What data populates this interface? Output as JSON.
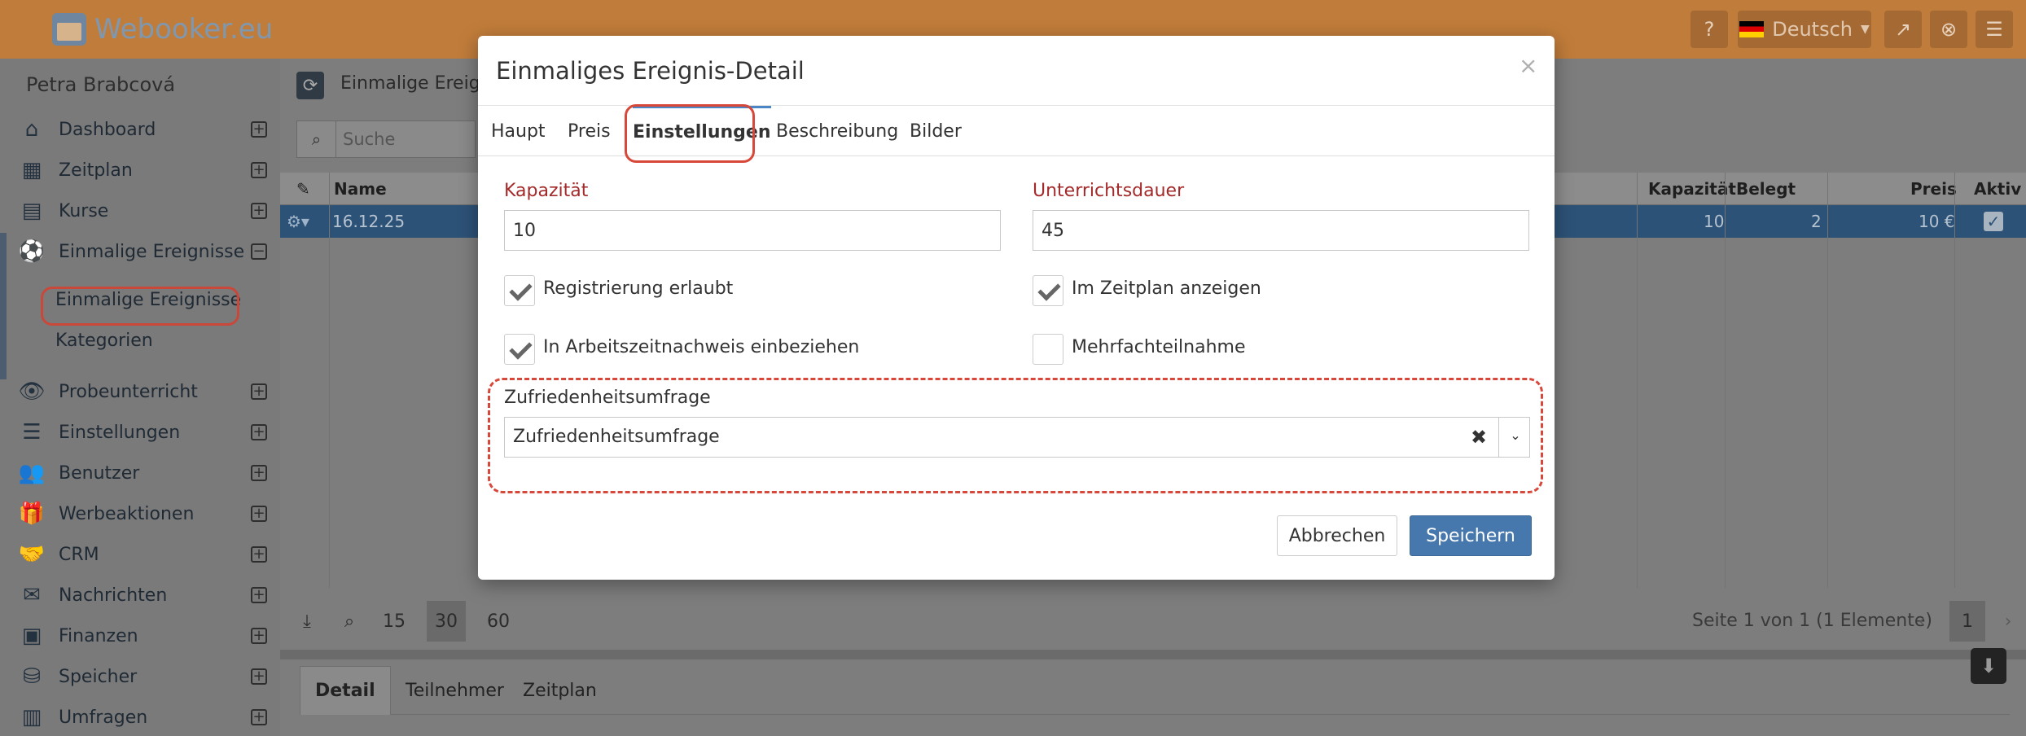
{
  "app": {
    "brand": "Webooker.eu",
    "language": "Deutsch",
    "colors": {
      "header": "#c07c3a",
      "primary": "#4778ad",
      "required": "#a32a2a",
      "annotation": "#d7483a"
    }
  },
  "sidebar": {
    "user": "Petra Brabcová",
    "items": [
      {
        "label": "Dashboard",
        "icon": "home-icon"
      },
      {
        "label": "Zeitplan",
        "icon": "calendar-icon"
      },
      {
        "label": "Kurse",
        "icon": "book-icon"
      },
      {
        "label": "Einmalige Ereignisse",
        "icon": "soccer-ball-icon",
        "expanded": true
      },
      {
        "label": "Probeunterricht",
        "icon": "eye-icon"
      },
      {
        "label": "Einstellungen",
        "icon": "server-icon"
      },
      {
        "label": "Benutzer",
        "icon": "users-icon"
      },
      {
        "label": "Werbeaktionen",
        "icon": "gift-icon"
      },
      {
        "label": "CRM",
        "icon": "handshake-icon"
      },
      {
        "label": "Nachrichten",
        "icon": "envelope-icon"
      },
      {
        "label": "Finanzen",
        "icon": "money-icon"
      },
      {
        "label": "Speicher",
        "icon": "database-icon"
      },
      {
        "label": "Umfragen",
        "icon": "chart-icon"
      }
    ],
    "subitems": [
      "Einmalige Ereignisse",
      "Kategorien"
    ]
  },
  "main": {
    "title": "Einmalige Ereignis",
    "search_placeholder": "Suche",
    "table": {
      "headers": {
        "name": "Name",
        "capacity": "Kapazität",
        "booked": "Belegt",
        "price": "Preis",
        "active": "Aktiv"
      },
      "rows": [
        {
          "name": "16.12.25",
          "capacity": "10",
          "booked": "2",
          "price": "10 €",
          "active": true
        }
      ]
    },
    "pager": {
      "sizes": [
        "15",
        "30",
        "60"
      ],
      "selected": "30",
      "info": "Seite 1 von 1 (1 Elemente)",
      "page": "1"
    },
    "bottom_tabs": [
      "Detail",
      "Teilnehmer",
      "Zeitplan"
    ]
  },
  "modal": {
    "title": "Einmaliges Ereignis-Detail",
    "close": "×",
    "tabs": [
      "Haupt",
      "Preis",
      "Einstellungen",
      "Beschreibung",
      "Bilder"
    ],
    "active_tab": "Einstellungen",
    "fields": {
      "capacity_label": "Kapazität",
      "capacity_value": "10",
      "duration_label": "Unterrichtsdauer",
      "duration_value": "45"
    },
    "checkboxes": [
      {
        "label": "Registrierung erlaubt",
        "checked": true
      },
      {
        "label": "Im Zeitplan anzeigen",
        "checked": true
      },
      {
        "label": "In Arbeitszeitnachweis einbeziehen",
        "checked": true
      },
      {
        "label": "Mehrfachteilnahme",
        "checked": false
      }
    ],
    "survey": {
      "label": "Zufriedenheitsumfrage",
      "value": "Zufriedenheitsumfrage"
    },
    "buttons": {
      "cancel": "Abbrechen",
      "save": "Speichern"
    }
  }
}
